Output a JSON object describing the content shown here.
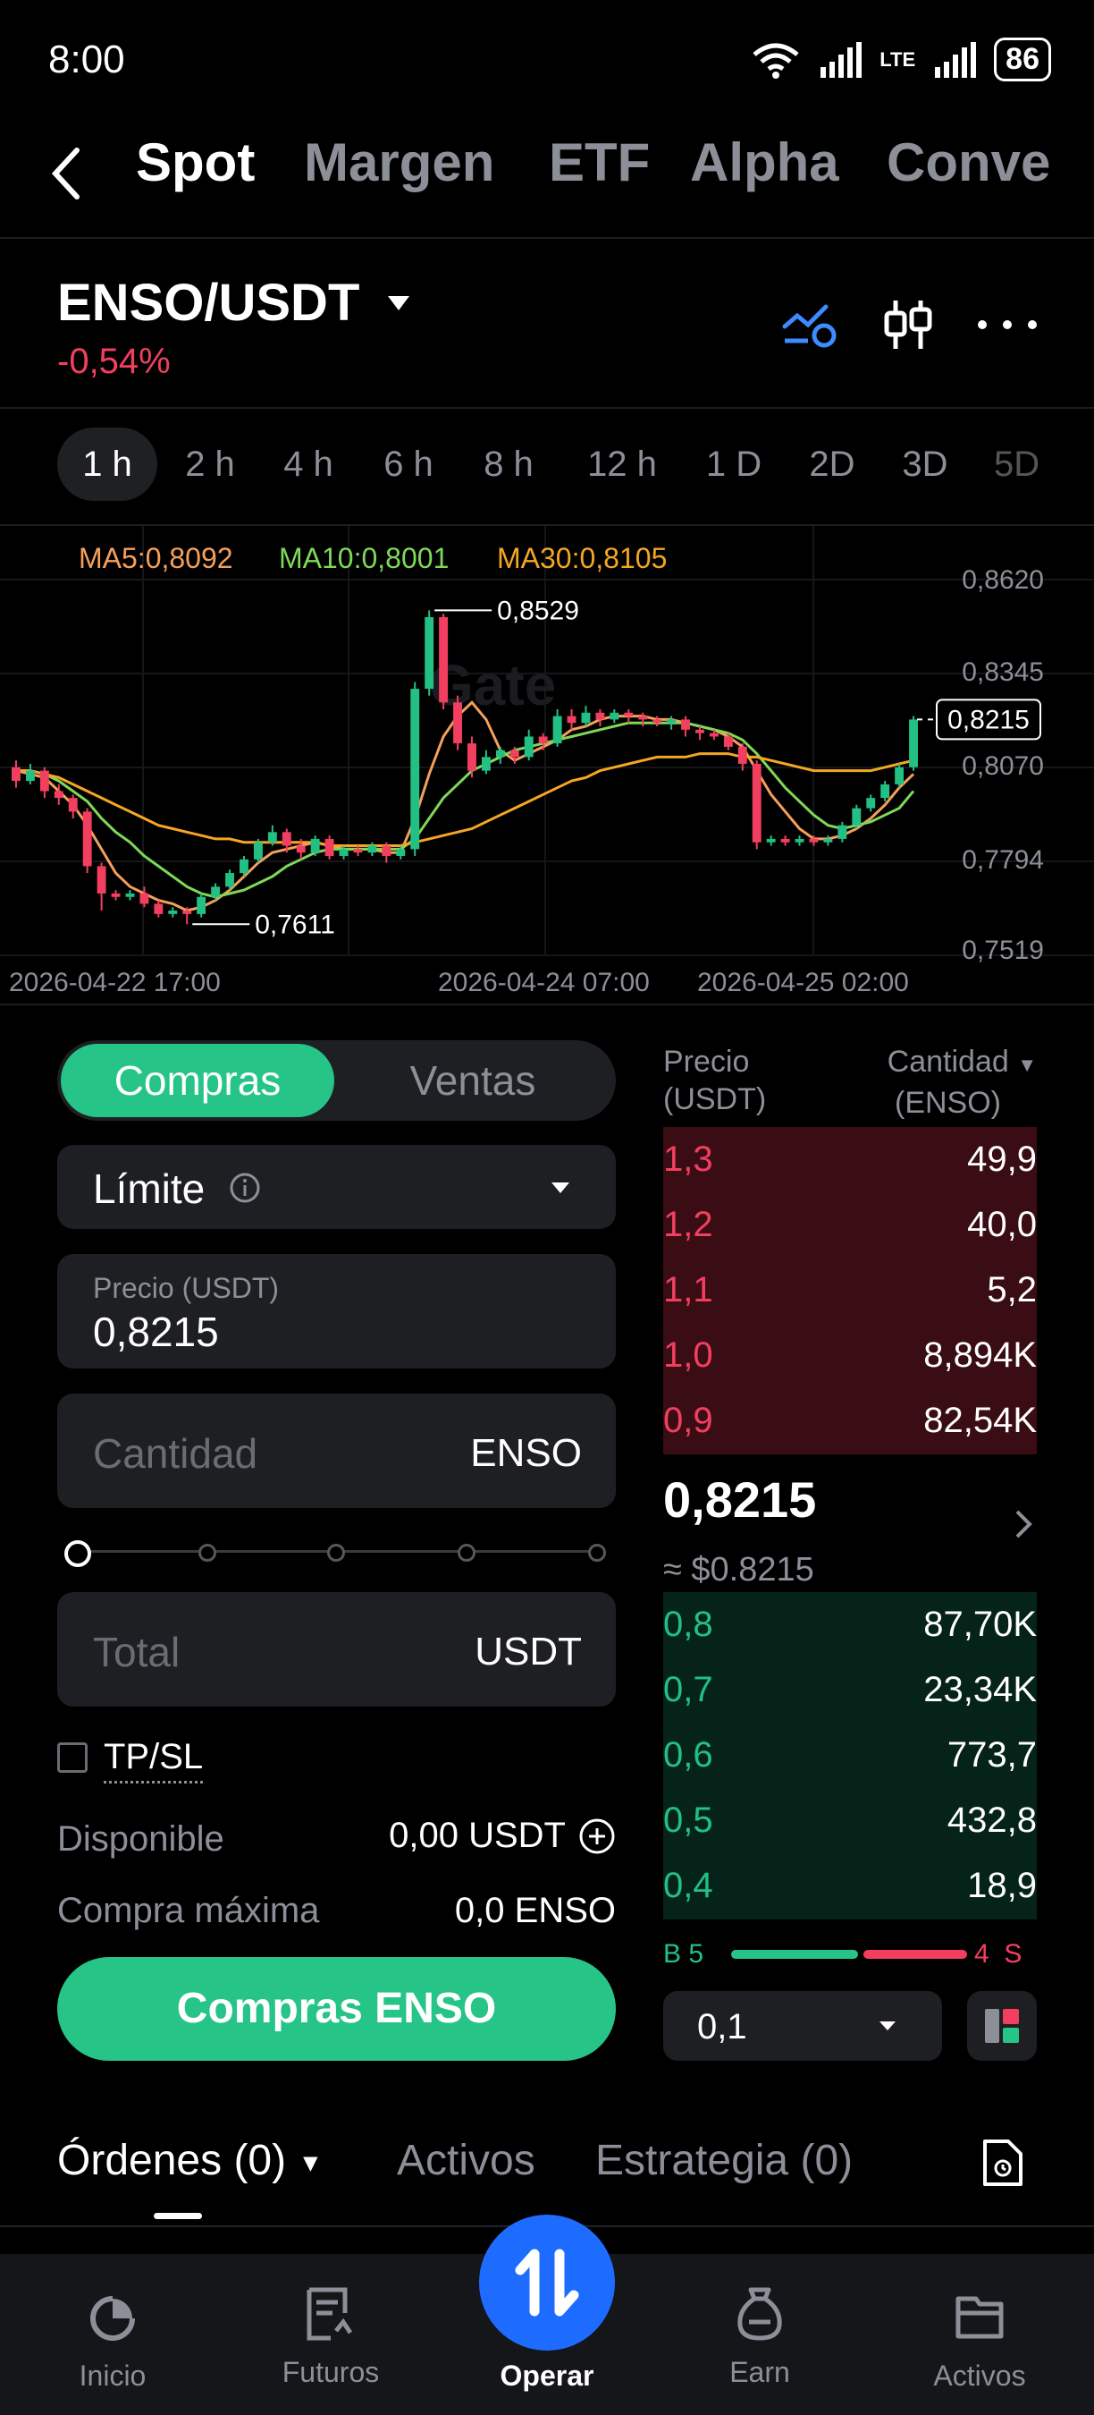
{
  "status": {
    "time": "8:00",
    "lte": "LTE",
    "battery": "86"
  },
  "nav": {
    "tabs": [
      "Spot",
      "Margen",
      "ETF",
      "Alpha",
      "Conve"
    ],
    "active": "Spot"
  },
  "pair": {
    "name": "ENSO/USDT",
    "change": "-0,54%"
  },
  "timeframes": [
    "1 h",
    "2 h",
    "4 h",
    "6 h",
    "8 h",
    "12 h",
    "1 D",
    "2D",
    "3D",
    "5D"
  ],
  "chart_data": {
    "type": "candlestick",
    "watermark": "Gate",
    "indicators": [
      {
        "name": "MA5",
        "value": "MA5:0,8092",
        "color": "#f5a623"
      },
      {
        "name": "MA10",
        "value": "MA10:0,8001",
        "color": "#7ed957"
      },
      {
        "name": "MA30",
        "value": "MA30:0,8105",
        "color": "#f5a623"
      }
    ],
    "y_ticks": [
      "0,8620",
      "0,8345",
      "0,8070",
      "0,7794",
      "0,7519"
    ],
    "x_ticks": [
      "2026-04-22 17:00",
      "2026-04-24 07:00",
      "2026-04-25 02:00"
    ],
    "ylim": [
      0.7519,
      0.862
    ],
    "annotations": {
      "high": "0,8529",
      "low": "0,7611",
      "last": "0,8215"
    },
    "candles": [
      [
        0.807,
        0.803,
        0.809,
        0.801
      ],
      [
        0.803,
        0.806,
        0.808,
        0.802
      ],
      [
        0.806,
        0.8,
        0.807,
        0.798
      ],
      [
        0.8,
        0.798,
        0.802,
        0.796
      ],
      [
        0.798,
        0.794,
        0.799,
        0.792
      ],
      [
        0.794,
        0.778,
        0.795,
        0.776
      ],
      [
        0.778,
        0.77,
        0.779,
        0.765
      ],
      [
        0.77,
        0.769,
        0.771,
        0.768
      ],
      [
        0.769,
        0.77,
        0.771,
        0.768
      ],
      [
        0.77,
        0.767,
        0.772,
        0.766
      ],
      [
        0.767,
        0.764,
        0.768,
        0.763
      ],
      [
        0.764,
        0.765,
        0.766,
        0.763
      ],
      [
        0.765,
        0.764,
        0.766,
        0.761
      ],
      [
        0.764,
        0.769,
        0.77,
        0.763
      ],
      [
        0.769,
        0.772,
        0.773,
        0.768
      ],
      [
        0.772,
        0.776,
        0.777,
        0.771
      ],
      [
        0.776,
        0.78,
        0.781,
        0.775
      ],
      [
        0.78,
        0.785,
        0.786,
        0.779
      ],
      [
        0.785,
        0.788,
        0.79,
        0.784
      ],
      [
        0.788,
        0.784,
        0.789,
        0.782
      ],
      [
        0.784,
        0.782,
        0.786,
        0.78
      ],
      [
        0.782,
        0.786,
        0.787,
        0.781
      ],
      [
        0.786,
        0.781,
        0.787,
        0.78
      ],
      [
        0.781,
        0.783,
        0.784,
        0.78
      ],
      [
        0.783,
        0.782,
        0.784,
        0.781
      ],
      [
        0.782,
        0.784,
        0.785,
        0.781
      ],
      [
        0.784,
        0.781,
        0.785,
        0.779
      ],
      [
        0.781,
        0.783,
        0.784,
        0.78
      ],
      [
        0.783,
        0.83,
        0.832,
        0.781
      ],
      [
        0.83,
        0.851,
        0.853,
        0.828
      ],
      [
        0.851,
        0.826,
        0.852,
        0.824
      ],
      [
        0.826,
        0.814,
        0.828,
        0.812
      ],
      [
        0.814,
        0.806,
        0.816,
        0.804
      ],
      [
        0.806,
        0.81,
        0.812,
        0.805
      ],
      [
        0.81,
        0.812,
        0.813,
        0.808
      ],
      [
        0.812,
        0.81,
        0.813,
        0.808
      ],
      [
        0.81,
        0.816,
        0.818,
        0.809
      ],
      [
        0.816,
        0.814,
        0.817,
        0.812
      ],
      [
        0.814,
        0.822,
        0.824,
        0.813
      ],
      [
        0.822,
        0.82,
        0.824,
        0.818
      ],
      [
        0.82,
        0.823,
        0.825,
        0.819
      ],
      [
        0.823,
        0.821,
        0.824,
        0.819
      ],
      [
        0.821,
        0.823,
        0.824,
        0.82
      ],
      [
        0.823,
        0.822,
        0.824,
        0.82
      ],
      [
        0.822,
        0.821,
        0.823,
        0.819
      ],
      [
        0.821,
        0.82,
        0.822,
        0.819
      ],
      [
        0.82,
        0.821,
        0.822,
        0.818
      ],
      [
        0.821,
        0.818,
        0.822,
        0.816
      ],
      [
        0.818,
        0.817,
        0.819,
        0.815
      ],
      [
        0.817,
        0.816,
        0.818,
        0.815
      ],
      [
        0.816,
        0.813,
        0.817,
        0.812
      ],
      [
        0.813,
        0.808,
        0.814,
        0.806
      ],
      [
        0.808,
        0.785,
        0.809,
        0.783
      ],
      [
        0.785,
        0.786,
        0.787,
        0.784
      ],
      [
        0.786,
        0.785,
        0.787,
        0.784
      ],
      [
        0.785,
        0.786,
        0.787,
        0.784
      ],
      [
        0.786,
        0.785,
        0.787,
        0.784
      ],
      [
        0.785,
        0.786,
        0.787,
        0.784
      ],
      [
        0.786,
        0.79,
        0.791,
        0.785
      ],
      [
        0.79,
        0.795,
        0.796,
        0.789
      ],
      [
        0.795,
        0.798,
        0.799,
        0.794
      ],
      [
        0.798,
        0.802,
        0.803,
        0.797
      ],
      [
        0.802,
        0.807,
        0.808,
        0.801
      ],
      [
        0.807,
        0.821,
        0.822,
        0.806
      ]
    ],
    "ma_lines": {
      "ma5": [
        0.806,
        0.805,
        0.804,
        0.8,
        0.796,
        0.79,
        0.783,
        0.776,
        0.772,
        0.77,
        0.768,
        0.767,
        0.765,
        0.766,
        0.768,
        0.771,
        0.775,
        0.779,
        0.782,
        0.783,
        0.784,
        0.785,
        0.784,
        0.783,
        0.783,
        0.783,
        0.782,
        0.782,
        0.792,
        0.805,
        0.816,
        0.822,
        0.826,
        0.821,
        0.812,
        0.809,
        0.811,
        0.813,
        0.815,
        0.818,
        0.819,
        0.821,
        0.822,
        0.822,
        0.822,
        0.821,
        0.821,
        0.82,
        0.819,
        0.818,
        0.816,
        0.813,
        0.806,
        0.799,
        0.794,
        0.789,
        0.786,
        0.786,
        0.787,
        0.789,
        0.792,
        0.796,
        0.801,
        0.805
      ],
      "ma10": [
        0.806,
        0.806,
        0.805,
        0.803,
        0.8,
        0.797,
        0.792,
        0.788,
        0.785,
        0.781,
        0.778,
        0.775,
        0.772,
        0.77,
        0.769,
        0.77,
        0.771,
        0.773,
        0.775,
        0.778,
        0.78,
        0.782,
        0.783,
        0.783,
        0.783,
        0.783,
        0.783,
        0.783,
        0.786,
        0.792,
        0.798,
        0.802,
        0.806,
        0.808,
        0.81,
        0.812,
        0.813,
        0.814,
        0.815,
        0.816,
        0.817,
        0.818,
        0.819,
        0.82,
        0.82,
        0.82,
        0.82,
        0.82,
        0.819,
        0.818,
        0.817,
        0.815,
        0.811,
        0.806,
        0.801,
        0.797,
        0.793,
        0.79,
        0.789,
        0.79,
        0.791,
        0.793,
        0.795,
        0.8
      ],
      "ma30": [
        0.806,
        0.806,
        0.805,
        0.804,
        0.802,
        0.8,
        0.798,
        0.796,
        0.794,
        0.792,
        0.79,
        0.789,
        0.788,
        0.787,
        0.786,
        0.786,
        0.785,
        0.785,
        0.785,
        0.785,
        0.785,
        0.785,
        0.784,
        0.784,
        0.784,
        0.784,
        0.784,
        0.784,
        0.785,
        0.786,
        0.787,
        0.788,
        0.789,
        0.791,
        0.793,
        0.795,
        0.797,
        0.799,
        0.801,
        0.803,
        0.804,
        0.806,
        0.807,
        0.808,
        0.809,
        0.81,
        0.81,
        0.81,
        0.811,
        0.811,
        0.811,
        0.81,
        0.81,
        0.809,
        0.808,
        0.807,
        0.806,
        0.806,
        0.806,
        0.806,
        0.806,
        0.807,
        0.808,
        0.809
      ]
    }
  },
  "order_form": {
    "buy_label": "Compras",
    "sell_label": "Ventas",
    "order_type": "Límite",
    "price_label": "Precio (USDT)",
    "price_value": "0,8215",
    "amount_placeholder": "Cantidad",
    "amount_unit": "ENSO",
    "total_placeholder": "Total",
    "total_unit": "USDT",
    "slider_percent": 0,
    "tpsl_label": "TP/SL",
    "available_label": "Disponible",
    "available_value": "0,00 USDT",
    "maxbuy_label": "Compra máxima",
    "maxbuy_value": "0,0 ENSO",
    "submit_label": "Compras ENSO"
  },
  "orderbook": {
    "price_header": "Precio",
    "price_unit": "(USDT)",
    "qty_header": "Cantidad",
    "qty_unit": "(ENSO)",
    "asks": [
      {
        "price": "1,3",
        "qty": "49,9"
      },
      {
        "price": "1,2",
        "qty": "40,0"
      },
      {
        "price": "1,1",
        "qty": "5,2"
      },
      {
        "price": "1,0",
        "qty": "8,894K"
      },
      {
        "price": "0,9",
        "qty": "82,54K"
      }
    ],
    "last_price": "0,8215",
    "last_price_usd": "≈ $0.8215",
    "bids": [
      {
        "price": "0,8",
        "qty": "87,70K"
      },
      {
        "price": "0,7",
        "qty": "23,34K"
      },
      {
        "price": "0,6",
        "qty": "773,7"
      },
      {
        "price": "0,5",
        "qty": "432,8"
      },
      {
        "price": "0,4",
        "qty": "18,9"
      }
    ],
    "ratio_b_label": "B 5",
    "ratio_s_label": "4  S",
    "buy_ratio": 0.55,
    "depth_value": "0,1"
  },
  "orders_tabs": [
    "Órdenes (0)",
    "Activos",
    "Estrategia (0)"
  ],
  "bottom_nav": [
    "Inicio",
    "Futuros",
    "Operar",
    "Earn",
    "Activos"
  ],
  "colors": {
    "green": "#27c487",
    "red": "#f23f5f",
    "accent_blue": "#1e6cff"
  }
}
